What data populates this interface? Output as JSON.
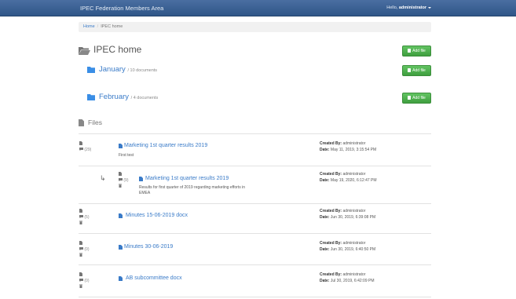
{
  "navbar": {
    "brand": "IPEC Federation Members Area",
    "greeting": "Hello,",
    "username": "administrator"
  },
  "breadcrumb": {
    "home": "Home",
    "separator": "/",
    "current": "IPEC home"
  },
  "page": {
    "title": "IPEC home",
    "add_file_label": "Add file"
  },
  "folders": [
    {
      "name": "January",
      "count": "/ 10 documents"
    },
    {
      "name": "February",
      "count": "/ 4 documents"
    }
  ],
  "files_heading": "Files",
  "created_by_label": "Created By:",
  "date_label": "Date:",
  "files": [
    {
      "name": "Marketing 1st quarter results 2019",
      "description": "First test",
      "comments": "(29)",
      "created_by": "administrator",
      "date": "May 11, 2019, 3:15:54 PM"
    },
    {
      "name": "Marketing 1st quarter results 2019",
      "description": "Results for first quarter of 2019 regarding marketing efforts in EMEA",
      "comments": "(9)",
      "created_by": "administrator",
      "date": "May 19, 2020, 6:12:47 PM"
    },
    {
      "name": "Minutes 15-06-2019 docx",
      "description": "",
      "comments": "(5)",
      "created_by": "administrator",
      "date": "Jun 30, 2019, 6:39:08 PM"
    },
    {
      "name": "Minutes 30-06-2019",
      "description": "",
      "comments": "(0)",
      "created_by": "administrator",
      "date": "Jun 30, 2019, 6:40:50 PM"
    },
    {
      "name": "AB subcommittee docx",
      "description": "",
      "comments": "(0)",
      "created_by": "administrator",
      "date": "Jul 30, 2019, 6:42:09 PM"
    }
  ],
  "icons": {
    "folder": "folder-icon",
    "file": "file-icon",
    "comment": "comment-icon",
    "trash": "trash-icon",
    "reply_arrow": "reply-arrow-icon"
  },
  "colors": {
    "navbar": "#3a6196",
    "link": "#3a7bc8",
    "button": "#4cae4c"
  }
}
